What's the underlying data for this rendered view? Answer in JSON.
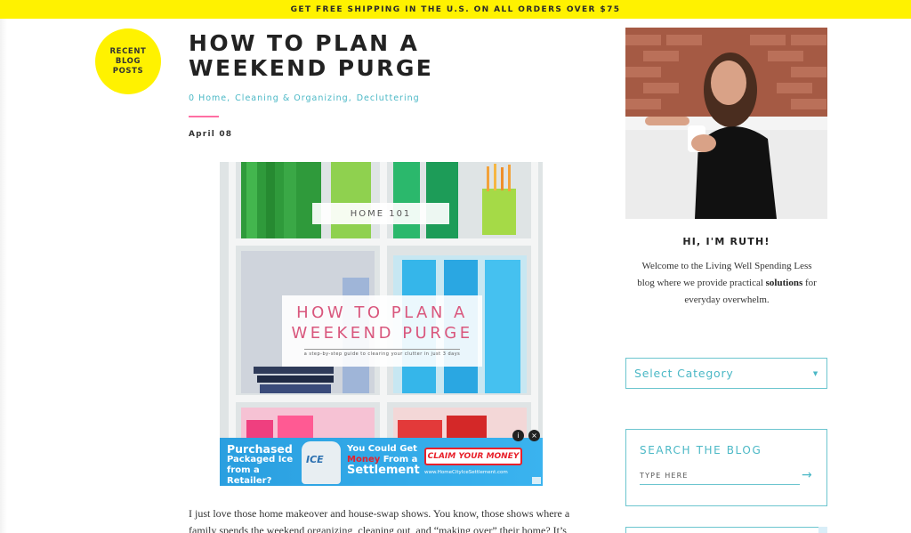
{
  "promo": {
    "text": "GET FREE SHIPPING IN THE U.S. ON ALL ORDERS OVER $75"
  },
  "badge": {
    "line1": "RECENT",
    "line2": "BLOG",
    "line3": "POSTS"
  },
  "post": {
    "title": "HOW TO PLAN A WEEKEND PURGE",
    "comments": "0",
    "categories": [
      "Home",
      "Cleaning & Organizing",
      "Decluttering"
    ],
    "date": "April 08",
    "body": "I just love those home makeover and house-swap shows. You know, those shows where a family spends the weekend organizing, cleaning out, and “making over” their home? It’s"
  },
  "hero": {
    "label": "HOME 101",
    "title_line1": "HOW TO PLAN A",
    "title_line2": "WEEKEND PURGE",
    "subtitle": "a step-by-step guide to clearing your clutter in just 3 days"
  },
  "ad": {
    "left_1": "Purchased",
    "left_2": "Packaged Ice",
    "left_3": "from a Retailer?",
    "ice_label": "ICE",
    "mid_1": "You Could Get",
    "mid_money": "Money",
    "mid_from": " From a",
    "mid_3": "Settlement",
    "cta": "CLAIM YOUR MONEY",
    "url": "www.HomeCityIceSettlement.com",
    "info_icon": "i",
    "close_icon": "×"
  },
  "sidebar": {
    "greeting": "HI, I'M RUTH!",
    "intro_before": "Welcome to the Living Well Spending Less blog where we provide practical ",
    "intro_bold": "solutions",
    "intro_after": " for everyday overwhelm.",
    "category_select": "Select Category",
    "search_title": "SEARCH THE BLOG",
    "search_placeholder": "TYPE HERE",
    "search_arrow": "→"
  },
  "colors": {
    "accent_yellow": "#fff200",
    "accent_teal": "#4bb8c6",
    "accent_pink": "#ff6fa3",
    "ad_blue": "#2a9fe0",
    "ad_red": "#e8202a"
  }
}
